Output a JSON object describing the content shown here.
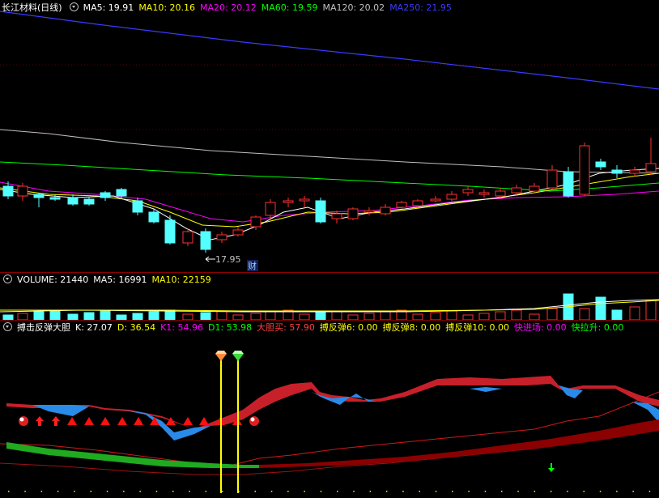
{
  "price_panel": {
    "stock_title": "长江材料(日线)",
    "ma": [
      {
        "label": "MA5: 19.91",
        "color": "#ffffff"
      },
      {
        "label": "MA10: 20.16",
        "color": "#ffff00"
      },
      {
        "label": "MA20: 20.12",
        "color": "#ff00ff"
      },
      {
        "label": "MA60: 19.59",
        "color": "#00ff00"
      },
      {
        "label": "MA120: 20.02",
        "color": "#c0c0c0"
      },
      {
        "label": "MA250: 21.95",
        "color": "#3a3aff"
      }
    ],
    "low_marker": "17.95",
    "finance_marker": "财"
  },
  "volume_panel": {
    "items": [
      {
        "label": "VOLUME: 21440",
        "color": "#ffffff"
      },
      {
        "label": "MA5: 16991",
        "color": "#ffffff"
      },
      {
        "label": "MA10: 22159",
        "color": "#ffff00"
      }
    ]
  },
  "indicator_panel": {
    "name": "搏击反弹大胆",
    "items": [
      {
        "label": "K: 27.07",
        "color": "#ffffff"
      },
      {
        "label": "D: 36.54",
        "color": "#ffff00"
      },
      {
        "label": "K1: 54.96",
        "color": "#ff00ff"
      },
      {
        "label": "D1: 53.98",
        "color": "#00ff00"
      },
      {
        "label": "大胆买: 57.90",
        "color": "#ff4040"
      },
      {
        "label": "搏反弹6: 0.00",
        "color": "#ffff00"
      },
      {
        "label": "搏反弹8: 0.00",
        "color": "#ffff00"
      },
      {
        "label": "搏反弹10: 0.00",
        "color": "#ffff00"
      },
      {
        "label": "快进场: 0.00",
        "color": "#ff00ff"
      },
      {
        "label": "快拉升: 0.00",
        "color": "#00ff00"
      }
    ]
  },
  "colors": {
    "up_candle": "#ff3030",
    "down_candle": "#54ffff",
    "separator": "#8b0000",
    "signal_line": "#ffff00"
  }
}
